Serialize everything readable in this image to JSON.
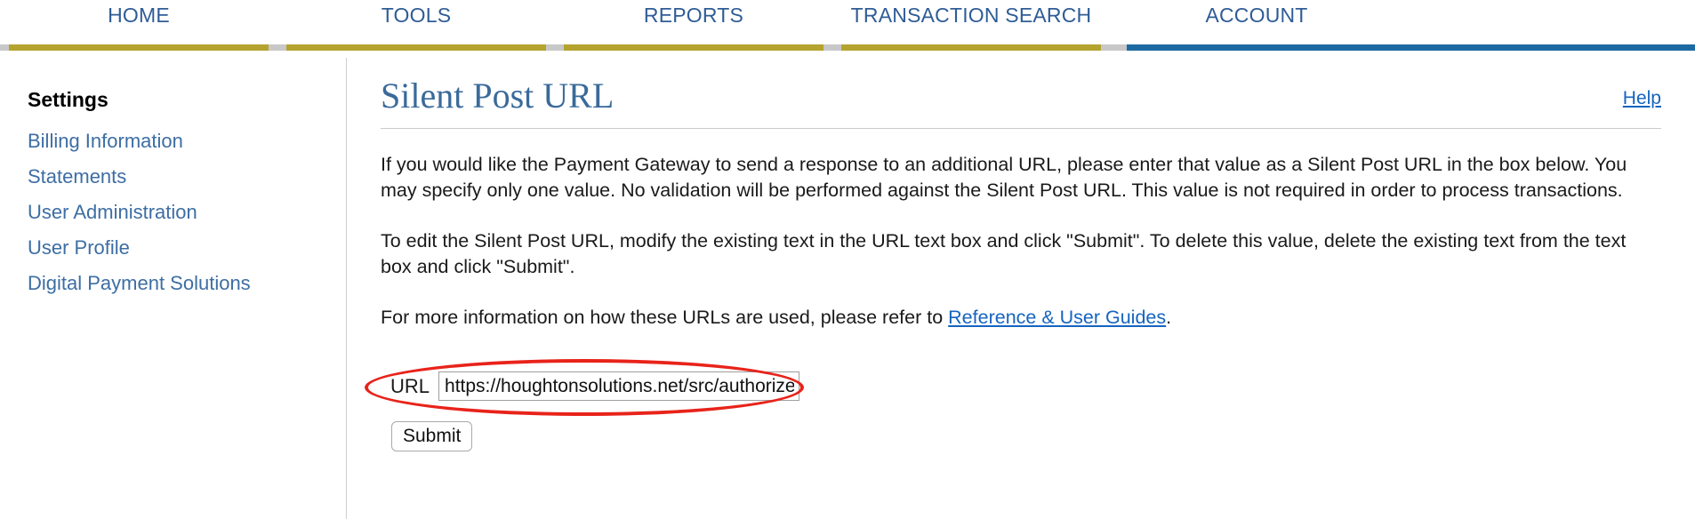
{
  "topnav": {
    "tabs": [
      {
        "label": "HOME",
        "active": false
      },
      {
        "label": "TOOLS",
        "active": false
      },
      {
        "label": "REPORTS",
        "active": false
      },
      {
        "label": "TRANSACTION SEARCH",
        "active": false
      },
      {
        "label": "ACCOUNT",
        "active": true
      }
    ],
    "inactive_bar_color": "#b5a32f",
    "active_bar_color": "#1d6aa3",
    "label_color": "#2f5c96"
  },
  "sidebar": {
    "heading": "Settings",
    "items": [
      {
        "label": "Billing Information"
      },
      {
        "label": "Statements"
      },
      {
        "label": "User Administration"
      },
      {
        "label": "User Profile"
      },
      {
        "label": "Digital Payment Solutions"
      }
    ],
    "link_color": "#3d6ea3"
  },
  "main": {
    "title": "Silent Post URL",
    "title_color": "#3a6a9a",
    "help_label": "Help",
    "paragraph1": "If you would like the Payment Gateway to send a response to an additional URL, please enter that value as a Silent Post URL in the box below. You may specify only one value. No validation will be performed against the Silent Post URL. This value is not required in order to process transactions.",
    "paragraph2": "To edit the Silent Post URL, modify the existing text in the URL text box and click \"Submit\". To delete this value, delete the existing text from the text box and click \"Submit\".",
    "paragraph3_before_link": "For more information on how these URLs are used, please refer to ",
    "paragraph3_link": "Reference & User Guides",
    "paragraph3_after_link": ".",
    "link_color": "#1564c0"
  },
  "form": {
    "url_label": "URL",
    "url_value": "https://houghtonsolutions.net/src/authorize",
    "url_placeholder": "",
    "submit_label": "Submit"
  },
  "annotation": {
    "shape": "ellipse",
    "color": "#e8231a",
    "target": "url-field-row"
  }
}
